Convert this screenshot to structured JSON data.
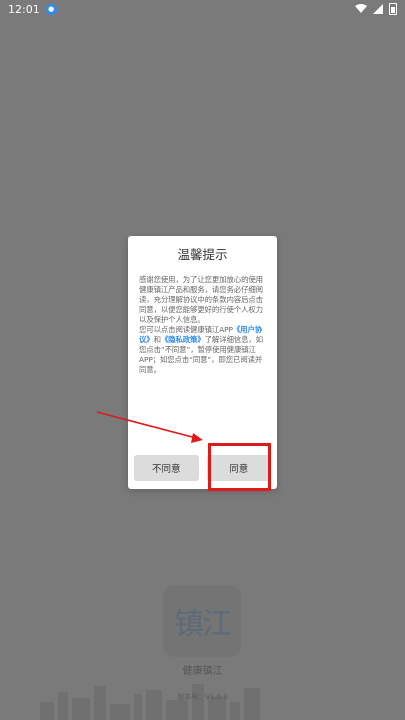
{
  "status": {
    "time": "12:01"
  },
  "splash": {
    "logo_text": "镇江",
    "app_name": "健康镇江",
    "version": "版本号：V1.0.0"
  },
  "dialog": {
    "title": "温馨提示",
    "para1": "感谢您使用，为了让您更加放心的使用健康镇江产品和服务，请您务必仔细阅读，充分理解协议中的条款内容后点击同意，以便您能够更好的行使个人权力以及保护个人信息。",
    "para2_prefix": "您可以点击阅读健康镇江APP",
    "user_agreement": "《用户协议》",
    "and": "和",
    "privacy_policy": "《隐私政策》",
    "para2_suffix": "了解详细信息，如您点击“不同意”，暂停使用健康镇江APP；如您点击“同意”，即您已阅读并同意。",
    "disagree_label": "不同意",
    "agree_label": "同意"
  },
  "annotation": {
    "color": "#e01a1a"
  }
}
